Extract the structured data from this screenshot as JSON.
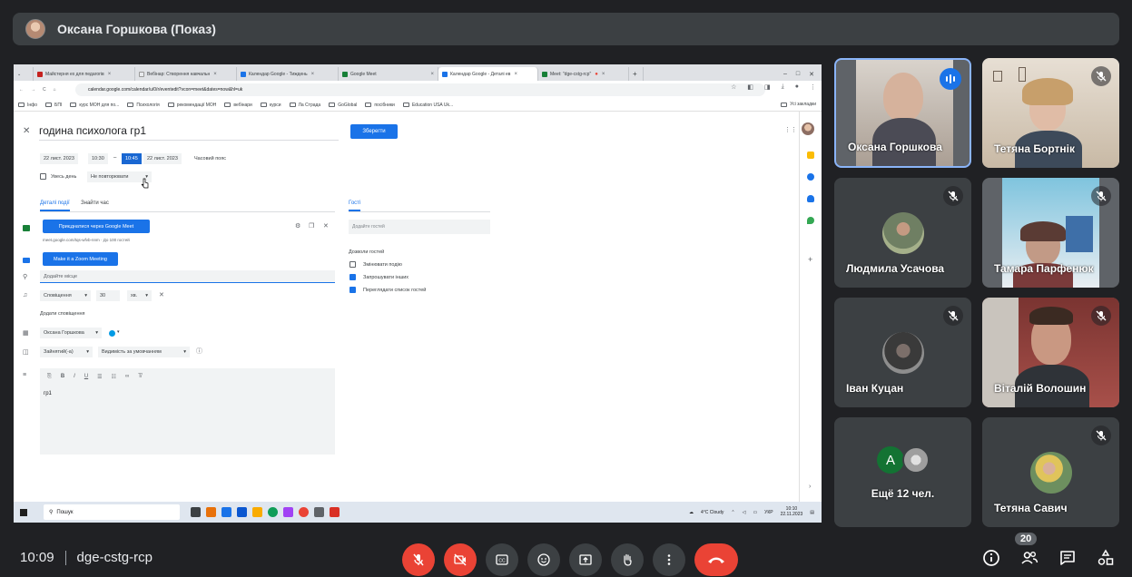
{
  "meeting": {
    "presenter_label": "Оксана Горшкова (Показ)",
    "time": "10:09",
    "code": "dge-cstg-rcp",
    "participant_count": "20"
  },
  "browser": {
    "tabs": [
      {
        "label": "Майстерня ex для педагогів",
        "favicon_color": "#c5221f"
      },
      {
        "label": "Вебінар: Створення навчальн",
        "favicon_color": "#e8eaed"
      },
      {
        "label": "Календар Google - Тиждень",
        "favicon_color": "#1a73e8"
      },
      {
        "label": "Google Meet",
        "favicon_color": "#188038"
      },
      {
        "label": "Календар Google - Деталі ев",
        "favicon_color": "#1a73e8"
      },
      {
        "label": "Meet: \"dge-cstg-rcp\"",
        "favicon_color": "#188038"
      }
    ],
    "url": "calendar.google.com/calendar/u/0/r/eventedit?vcon=meet&dates=now&hl=uk",
    "bookmarks": [
      "Інфо",
      "БПІ",
      "курс МОН для по...",
      "Психологія",
      "рекомендації МОН",
      "вебінари",
      "курси",
      "Ла Страда",
      "GoGlobal",
      "посібники",
      "Education USA Uk..."
    ],
    "bookmarks_right": "Усі закладки"
  },
  "event": {
    "title": "година психолога гр1",
    "save_label": "Зберегти",
    "start_date": "22 лист. 2023",
    "start_time": "10:30",
    "dash": "–",
    "end_time": "10:45",
    "end_date": "22 лист. 2023",
    "timezone_label": "Часовий пояс",
    "all_day_label": "Увесь день",
    "repeat_value": "Не повторювати",
    "tab_details": "Деталі події",
    "tab_find_time": "Знайти час",
    "meet_button": "Приєднатися через Google Meet",
    "meet_info": "meet.google.com/tqs-wfvb-nnm · До 100 гостей",
    "zoom_button": "Make it a Zoom Meeting",
    "location_placeholder": "Додайте місце",
    "notification_type": "Сповіщення",
    "notification_value": "30",
    "notification_unit": "хв.",
    "add_notification": "Додати сповіщення",
    "calendar_owner": "Оксана Горшкова",
    "busy_value": "Зайнятий(-а)",
    "visibility_value": "Видимість за умовчанням",
    "description": "гр1"
  },
  "guests": {
    "tab_label": "Гості",
    "add_placeholder": "Додайте гостей",
    "permissions_title": "Дозволи гостей",
    "permissions": [
      {
        "label": "Змінювати подію",
        "checked": false
      },
      {
        "label": "Запрошувати інших",
        "checked": true
      },
      {
        "label": "Переглядати список гостей",
        "checked": true
      }
    ]
  },
  "taskbar": {
    "search_label": "Пошук",
    "weather": "4°C Cloudy",
    "lang": "УКР",
    "clock_time": "10:10",
    "clock_date": "22.11.2023"
  },
  "participants": [
    {
      "name": "Оксана Горшкова",
      "state": "speaking"
    },
    {
      "name": "Тетяна Бортнік",
      "state": "muted"
    },
    {
      "name": "Людмила Усачова",
      "state": "muted"
    },
    {
      "name": "Тамара Парфенюк",
      "state": "muted"
    },
    {
      "name": "Іван Куцан",
      "state": "muted"
    },
    {
      "name": "Віталій Волошин",
      "state": "muted"
    },
    {
      "name": "Ещё 12 чел.",
      "avatar_letter": "A"
    },
    {
      "name": "Тетяна Савич",
      "state": "muted"
    }
  ],
  "colors": {
    "meet_bg": "#202124",
    "tile_bg": "#3c4043",
    "danger": "#ea4335",
    "google_blue": "#1a73e8"
  }
}
